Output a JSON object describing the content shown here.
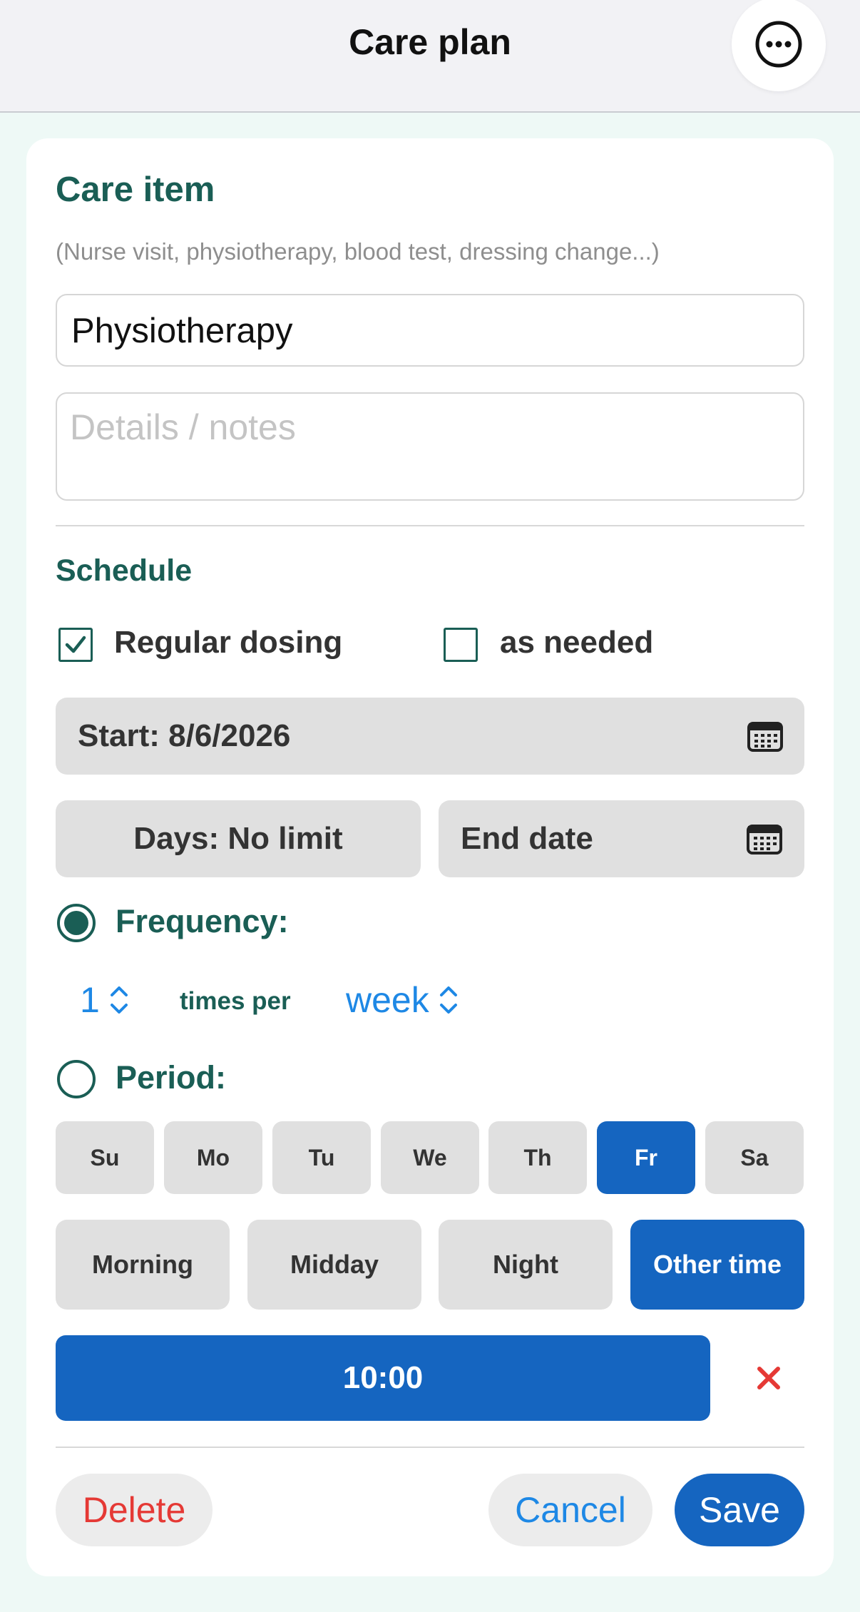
{
  "header": {
    "title": "Care plan",
    "more_icon": "ellipsis-circle-icon"
  },
  "care_item": {
    "title": "Care item",
    "hint": "(Nurse visit, physiotherapy, blood test, dressing change...)",
    "name_value": "Physiotherapy",
    "notes_placeholder": "Details / notes"
  },
  "schedule": {
    "title": "Schedule",
    "regular_label": "Regular dosing",
    "regular_checked": true,
    "as_needed_label": "as needed",
    "as_needed_checked": false,
    "start_label": "Start: 8/6/2026",
    "days_label": "Days: No limit",
    "end_label": "End date",
    "calendar_icon": "calendar-icon",
    "frequency_label": "Frequency:",
    "frequency_selected": true,
    "frequency_count": "1",
    "times_per_label": "times per",
    "frequency_unit": "week",
    "period_label": "Period:",
    "period_selected": false,
    "days": [
      {
        "label": "Su",
        "active": false
      },
      {
        "label": "Mo",
        "active": false
      },
      {
        "label": "Tu",
        "active": false
      },
      {
        "label": "We",
        "active": false
      },
      {
        "label": "Th",
        "active": false
      },
      {
        "label": "Fr",
        "active": true
      },
      {
        "label": "Sa",
        "active": false
      }
    ],
    "times": [
      {
        "label": "Morning",
        "active": false
      },
      {
        "label": "Midday",
        "active": false
      },
      {
        "label": "Night",
        "active": false
      },
      {
        "label": "Other time",
        "active": true
      }
    ],
    "time_value": "10:00",
    "remove_icon": "close-icon"
  },
  "footer": {
    "delete_label": "Delete",
    "cancel_label": "Cancel",
    "save_label": "Save"
  },
  "colors": {
    "accent": "#1565c0",
    "heading": "#1a5e55",
    "danger": "#e53935",
    "link": "#1e88e5"
  }
}
